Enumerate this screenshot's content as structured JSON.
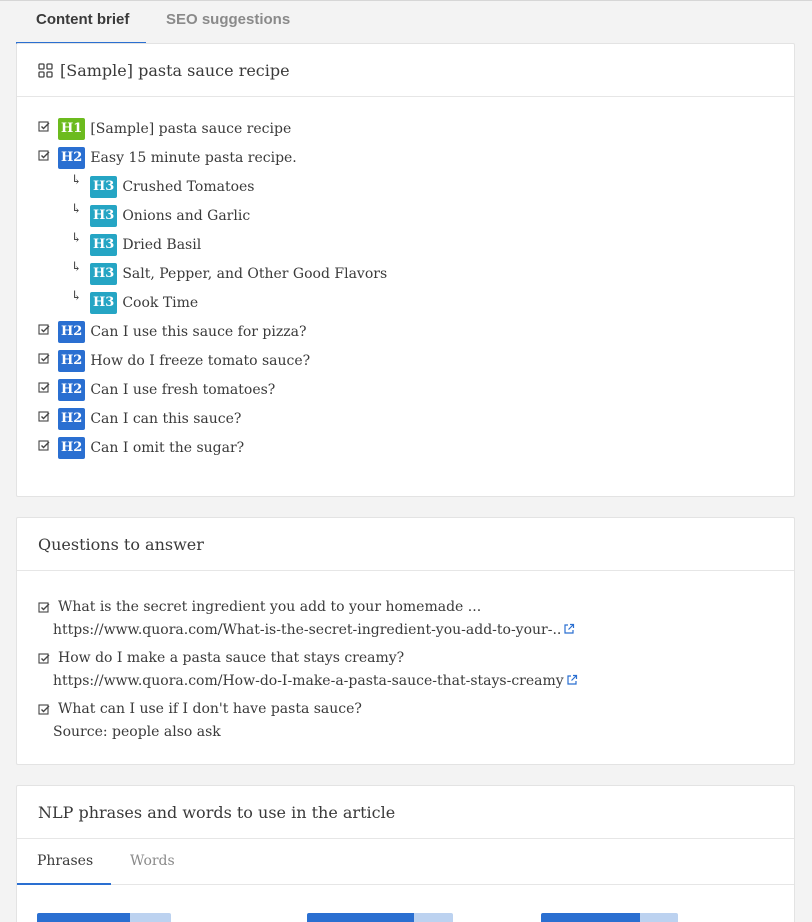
{
  "tabs": [
    {
      "label": "Content brief"
    },
    {
      "label": "SEO suggestions"
    }
  ],
  "brief": {
    "title": "[Sample] pasta sauce recipe",
    "items": [
      {
        "level": "H1",
        "text": "[Sample] pasta sauce recipe"
      },
      {
        "level": "H2",
        "text": "Easy 15 minute pasta recipe."
      },
      {
        "level": "H3",
        "text": "Crushed Tomatoes"
      },
      {
        "level": "H3",
        "text": "Onions and Garlic"
      },
      {
        "level": "H3",
        "text": "Dried Basil"
      },
      {
        "level": "H3",
        "text": "Salt, Pepper, and Other Good Flavors"
      },
      {
        "level": "H3",
        "text": "Cook Time"
      },
      {
        "level": "H2",
        "text": "Can I use this sauce for pizza?"
      },
      {
        "level": "H2",
        "text": "How do I freeze tomato sauce?"
      },
      {
        "level": "H2",
        "text": "Can I use fresh tomatoes?"
      },
      {
        "level": "H2",
        "text": "Can I can this sauce?"
      },
      {
        "level": "H2",
        "text": "Can I omit the sugar?"
      }
    ]
  },
  "questions": {
    "title": "Questions to answer",
    "items": [
      {
        "question": "What is the secret ingredient you add to your homemade ...",
        "source": "https://www.quora.com/What-is-the-secret-ingredient-you-add-to-your-.."
      },
      {
        "question": "How do I make a pasta sauce that stays creamy?",
        "source": "https://www.quora.com/How-do-I-make-a-pasta-sauce-that-stays-creamy"
      },
      {
        "question": "What can I use if I don't have pasta sauce?",
        "source": "Source: people also ask"
      }
    ]
  },
  "nlp": {
    "title": "NLP phrases and words to use in the article",
    "tabs": [
      {
        "label": "Phrases"
      },
      {
        "label": "Words"
      }
    ]
  },
  "colors": {
    "h1": "#6cbb1e",
    "h2": "#2a6fd1",
    "h3": "#25a5c4",
    "accent": "#2a6fd1"
  }
}
